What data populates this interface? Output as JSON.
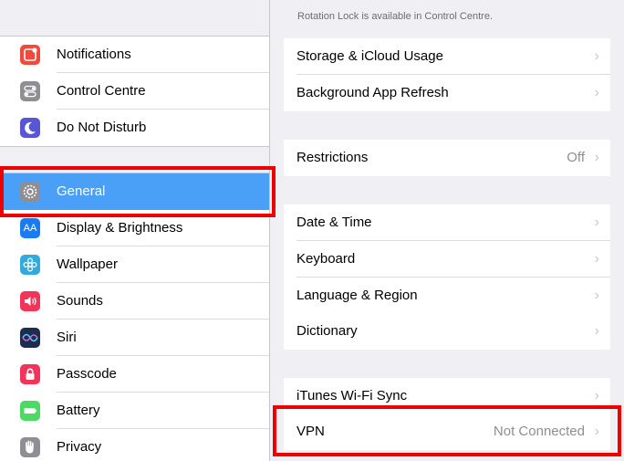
{
  "sidebar": {
    "groups": [
      [
        {
          "label": "Notifications",
          "icon": "notifications-icon",
          "color": "#f04a3c"
        },
        {
          "label": "Control Centre",
          "icon": "control-centre-icon",
          "color": "#8e8e93"
        },
        {
          "label": "Do Not Disturb",
          "icon": "moon-icon",
          "color": "#5856d6"
        }
      ],
      [
        {
          "label": "General",
          "icon": "gear-icon",
          "color": "#8e8e93",
          "selected": true
        },
        {
          "label": "Display & Brightness",
          "icon": "display-icon",
          "color": "#1a7cf4"
        },
        {
          "label": "Wallpaper",
          "icon": "wallpaper-icon",
          "color": "#34aadc"
        },
        {
          "label": "Sounds",
          "icon": "speaker-icon",
          "color": "#f2335a"
        },
        {
          "label": "Siri",
          "icon": "siri-icon",
          "color": "#1e2c4d"
        },
        {
          "label": "Passcode",
          "icon": "lock-icon",
          "color": "#f2335a"
        },
        {
          "label": "Battery",
          "icon": "battery-icon",
          "color": "#4cd964"
        },
        {
          "label": "Privacy",
          "icon": "hand-icon",
          "color": "#8e8e93"
        }
      ]
    ]
  },
  "main": {
    "note": "Rotation Lock is available in Control Centre.",
    "groups": [
      [
        {
          "label": "Storage & iCloud Usage"
        },
        {
          "label": "Background App Refresh"
        }
      ],
      [
        {
          "label": "Restrictions",
          "value": "Off"
        }
      ],
      [
        {
          "label": "Date & Time"
        },
        {
          "label": "Keyboard"
        },
        {
          "label": "Language & Region"
        },
        {
          "label": "Dictionary"
        }
      ],
      [
        {
          "label": "iTunes Wi-Fi Sync"
        },
        {
          "label": "VPN",
          "value": "Not Connected"
        }
      ]
    ]
  },
  "chevron": "›"
}
